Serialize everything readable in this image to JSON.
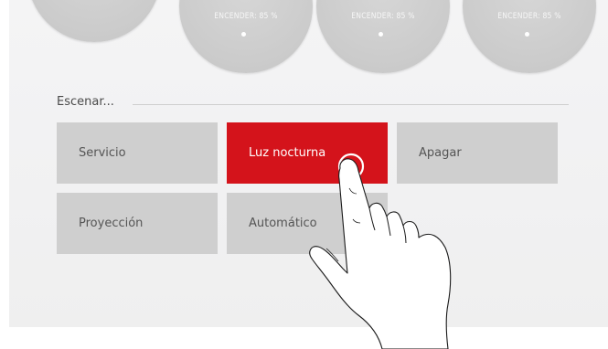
{
  "dials": [
    {
      "label": ""
    },
    {
      "label": "ENCENDER: 85 %"
    },
    {
      "label": "ENCENDER: 85 %"
    },
    {
      "label": "ENCENDER: 85 %"
    }
  ],
  "scenes": {
    "title": "Escenar...",
    "buttons": [
      {
        "label": "Servicio",
        "active": false
      },
      {
        "label": "Luz nocturna",
        "active": true
      },
      {
        "label": "Apagar",
        "active": false
      },
      {
        "label": "Proyección",
        "active": false
      },
      {
        "label": "Automático",
        "active": false
      }
    ]
  },
  "colors": {
    "accent": "#d4131b",
    "button": "#cfcfcf",
    "dial": "#cbcbcb"
  },
  "icons": {
    "pointer": "hand-pointer-icon"
  }
}
